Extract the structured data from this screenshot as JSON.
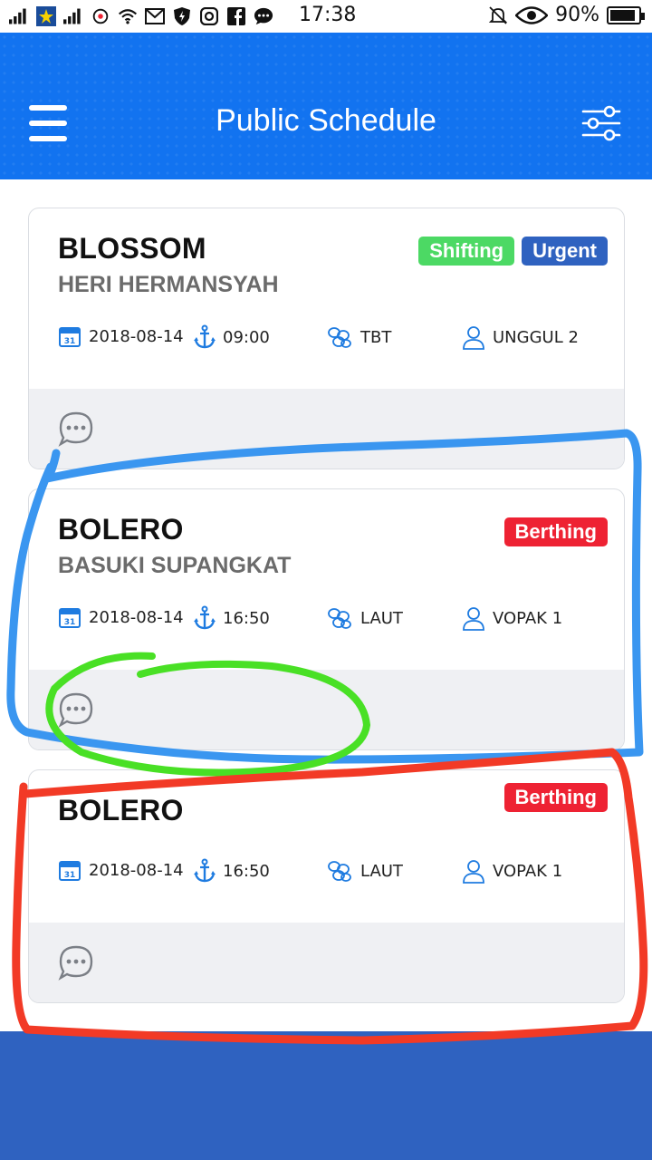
{
  "status_bar": {
    "time": "17:38",
    "battery": "90%",
    "battery_level": 0.9,
    "icons": [
      "signal-icon",
      "sim-star-icon",
      "signal-icon",
      "location-icon",
      "wifi-icon",
      "gmail-icon",
      "shield-icon",
      "instagram-icon",
      "facebook-icon",
      "chat-icon",
      "mute-bell-icon",
      "eye-icon",
      "battery-icon"
    ]
  },
  "header": {
    "title": "Public Schedule",
    "menu_icon": "hamburger-icon",
    "filter_icon": "filter-sliders-icon",
    "bg_color": "#1273f0"
  },
  "cards": [
    {
      "vessel": "BLOSSOM",
      "agent": "HERI HERMANSYAH",
      "badges": [
        {
          "label": "Shifting",
          "color": "#4cd964"
        },
        {
          "label": "Urgent",
          "color": "#2f62c0"
        }
      ],
      "date": "2018-08-14",
      "time": "09:00",
      "location": "TBT",
      "pilot": "UNGGUL 2"
    },
    {
      "vessel": "BOLERO",
      "agent": "BASUKI SUPANGKAT",
      "badges": [
        {
          "label": "Berthing",
          "color": "#ee2233"
        }
      ],
      "date": "2018-08-14",
      "time": "16:50",
      "location": "LAUT",
      "pilot": "VOPAK 1"
    },
    {
      "vessel": "BOLERO",
      "agent": "",
      "badges": [
        {
          "label": "Berthing",
          "color": "#ee2233"
        }
      ],
      "date": "2018-08-14",
      "time": "16:50",
      "location": "LAUT",
      "pilot": "VOPAK 1"
    }
  ],
  "annotation_colors": {
    "blue": "#3a96f0",
    "green": "#49e025",
    "red": "#f23a26"
  },
  "bottom_band_color": "#2f62c0"
}
